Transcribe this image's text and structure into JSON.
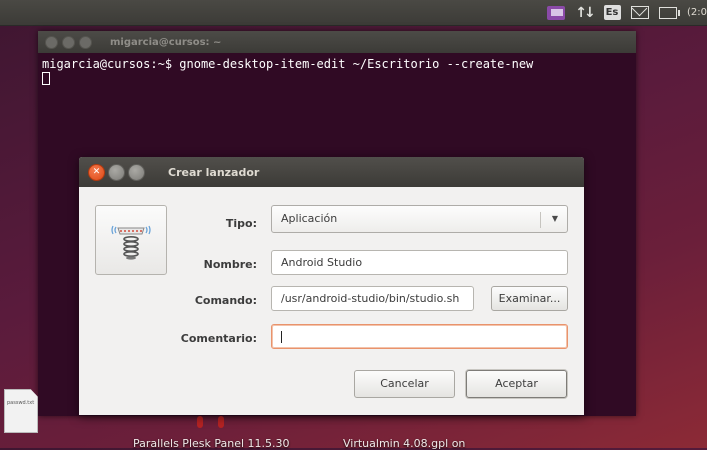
{
  "top_panel": {
    "keyboard_layout": "Es",
    "clock_partial": "(2:0",
    "icons": [
      "messaging-icon",
      "network-icon",
      "keyboard-icon",
      "mail-icon",
      "battery-icon"
    ]
  },
  "terminal": {
    "title": "migarcia@cursos: ~",
    "prompt": "migarcia@cursos:~$",
    "command": " gnome-desktop-item-edit ~/Escritorio --create-new"
  },
  "desktop": {
    "file_label": "passwd.txt",
    "bottom_labels": [
      "Parallels Plesk Panel 11.5.30",
      "Virtualmin 4.08.gpl on"
    ]
  },
  "dialog": {
    "title": "Crear lanzador",
    "fields": {
      "type_label": "Tipo:",
      "type_value": "Aplicación",
      "name_label": "Nombre:",
      "name_value": "Android Studio",
      "command_label": "Comando:",
      "command_value": "/usr/android-studio/bin/studio.sh",
      "comment_label": "Comentario:",
      "comment_value": ""
    },
    "buttons": {
      "browse": "Examinar...",
      "cancel": "Cancelar",
      "accept": "Aceptar"
    }
  },
  "colors": {
    "ubuntu_orange": "#dd4814",
    "terminal_bg": "#300a24",
    "panel_bg": "#3c3b37",
    "dialog_bg": "#f2f1f0"
  }
}
